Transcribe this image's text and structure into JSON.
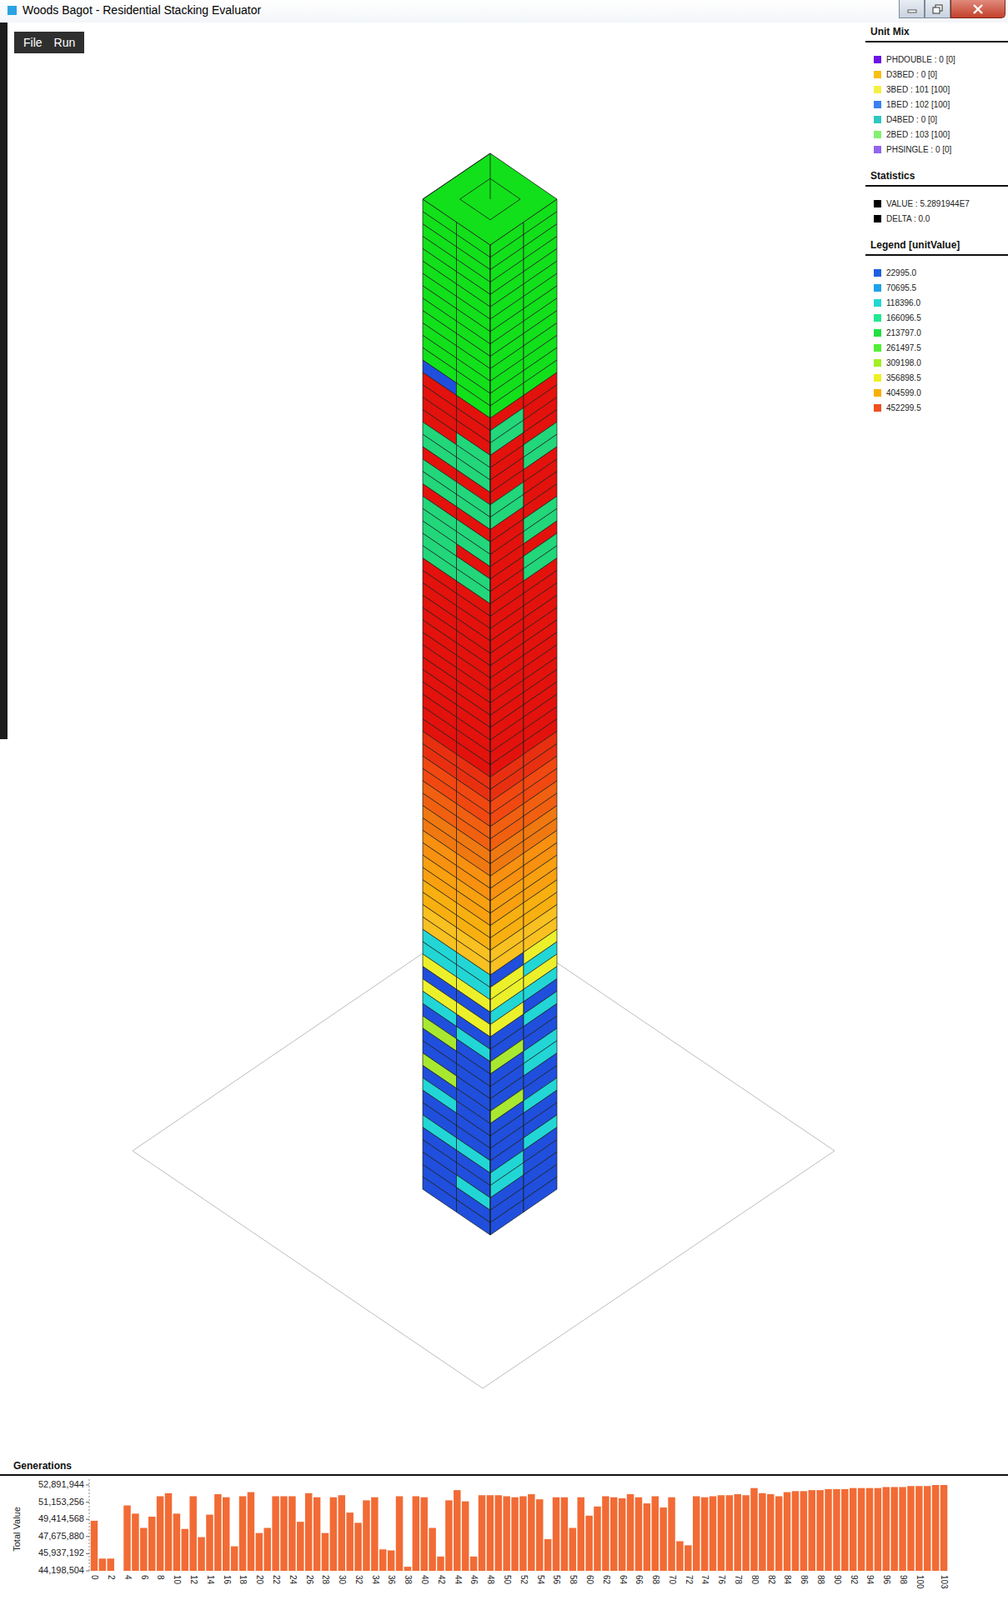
{
  "window": {
    "title": "Woods Bagot - Residential Stacking Evaluator"
  },
  "menu": [
    "File",
    "Run"
  ],
  "unit_mix": {
    "title": "Unit Mix",
    "items": [
      {
        "label": "PHDOUBLE : 0 [0]",
        "color": "#6b14e6"
      },
      {
        "label": "D3BED : 0 [0]",
        "color": "#f6c014"
      },
      {
        "label": "3BED : 101 [100]",
        "color": "#f4f046"
      },
      {
        "label": "1BED : 102 [100]",
        "color": "#3a82f0"
      },
      {
        "label": "D4BED : 0 [0]",
        "color": "#2ec8c0"
      },
      {
        "label": "2BED : 103 [100]",
        "color": "#84f070"
      },
      {
        "label": "PHSINGLE : 0 [0]",
        "color": "#9464f0"
      }
    ]
  },
  "statistics": {
    "title": "Statistics",
    "items": [
      {
        "label": "VALUE : 5.2891944E7",
        "color": "#000000"
      },
      {
        "label": "DELTA : 0.0",
        "color": "#000000"
      }
    ]
  },
  "legend": {
    "title": "Legend [unitValue]",
    "items": [
      {
        "label": "22995.0",
        "color": "#1f5fe0"
      },
      {
        "label": "70695.5",
        "color": "#1ea2ea"
      },
      {
        "label": "118396.0",
        "color": "#22d8d2"
      },
      {
        "label": "166096.5",
        "color": "#22e892"
      },
      {
        "label": "213797.0",
        "color": "#22e042"
      },
      {
        "label": "261497.5",
        "color": "#52f032"
      },
      {
        "label": "309198.0",
        "color": "#a2f022"
      },
      {
        "label": "356898.5",
        "color": "#f0f022"
      },
      {
        "label": "404599.0",
        "color": "#f8b000"
      },
      {
        "label": "452299.5",
        "color": "#f05020"
      }
    ]
  },
  "tower": {
    "roof_color": "#12e01a",
    "bands": [
      {
        "floors": 13,
        "units": [
          "#12e01a",
          "#12e01a",
          "#12e01a",
          "#12e01a"
        ]
      },
      {
        "floors": 1,
        "units": [
          "#1f4fdc",
          "#12e01a",
          "#12e01a",
          "#12e01a"
        ]
      },
      {
        "floors": 1,
        "units": [
          "#e3120c",
          "#e3120c",
          "#e3120c",
          "#e3120c"
        ]
      },
      {
        "floors": 2,
        "units": [
          "#e3120c",
          "#e3120c",
          "#22d67a",
          "#e3120c"
        ]
      },
      {
        "floors": 1,
        "units": [
          "#e3120c",
          "#22d67a",
          "#e3120c",
          "#e3120c"
        ]
      },
      {
        "floors": 2,
        "units": [
          "#22d67a",
          "#22d67a",
          "#e3120c",
          "#22d67a"
        ]
      },
      {
        "floors": 1,
        "units": [
          "#e3120c",
          "#e3120c",
          "#e3120c",
          "#e3120c"
        ]
      },
      {
        "floors": 2,
        "units": [
          "#22d67a",
          "#22d67a",
          "#22d67a",
          "#e3120c"
        ]
      },
      {
        "floors": 1,
        "units": [
          "#e3120c",
          "#e3120c",
          "#e3120c",
          "#e3120c"
        ]
      },
      {
        "floors": 2,
        "units": [
          "#22d67a",
          "#22d67a",
          "#e3120c",
          "#22d67a"
        ]
      },
      {
        "floors": 1,
        "units": [
          "#22d67a",
          "#e3120c",
          "#e3120c",
          "#e3120c"
        ]
      },
      {
        "floors": 2,
        "units": [
          "#22d67a",
          "#22d67a",
          "#e3120c",
          "#22d67a"
        ]
      },
      {
        "floors": 14,
        "units": [
          "#e3120c",
          "#e3120c",
          "#e3120c",
          "#e3120c"
        ]
      },
      {
        "floors": 2,
        "units": [
          "#e83010",
          "#e83010",
          "#e83010",
          "#e83010"
        ]
      },
      {
        "floors": 2,
        "units": [
          "#f04810",
          "#f04810",
          "#f04810",
          "#f04810"
        ]
      },
      {
        "floors": 2,
        "units": [
          "#f06010",
          "#f06010",
          "#f06010",
          "#f06010"
        ]
      },
      {
        "floors": 2,
        "units": [
          "#f07810",
          "#f07810",
          "#f07810",
          "#f07810"
        ]
      },
      {
        "floors": 2,
        "units": [
          "#f89010",
          "#f89010",
          "#f89010",
          "#f89010"
        ]
      },
      {
        "floors": 2,
        "units": [
          "#f8a010",
          "#f8a010",
          "#f8a010",
          "#f8a010"
        ]
      },
      {
        "floors": 2,
        "units": [
          "#f8b010",
          "#f8b010",
          "#f8b010",
          "#f8b010"
        ]
      },
      {
        "floors": 2,
        "units": [
          "#f8c020",
          "#f8c020",
          "#f8c020",
          "#f8c020"
        ]
      },
      {
        "floors": 1,
        "units": [
          "#22d6d6",
          "#22d6d6",
          "#1f4fdc",
          "#ecf02a"
        ]
      },
      {
        "floors": 1,
        "units": [
          "#22d6d6",
          "#22d6d6",
          "#ecf02a",
          "#22d6d6"
        ]
      },
      {
        "floors": 1,
        "units": [
          "#ecf02a",
          "#ecf02a",
          "#ecf02a",
          "#ecf02a"
        ]
      },
      {
        "floors": 1,
        "units": [
          "#1f4fdc",
          "#1f4fdc",
          "#22d6d6",
          "#22d6d6"
        ]
      },
      {
        "floors": 1,
        "units": [
          "#ecf02a",
          "#ecf02a",
          "#ecf02a",
          "#1f4fdc"
        ]
      },
      {
        "floors": 1,
        "units": [
          "#22d6d6",
          "#1f4fdc",
          "#1f4fdc",
          "#22d6d6"
        ]
      },
      {
        "floors": 1,
        "units": [
          "#1f4fdc",
          "#22d6d6",
          "#1f4fdc",
          "#1f4fdc"
        ]
      },
      {
        "floors": 1,
        "units": [
          "#a8e830",
          "#1f4fdc",
          "#a8e830",
          "#1f4fdc"
        ]
      },
      {
        "floors": 2,
        "units": [
          "#1f4fdc",
          "#1f4fdc",
          "#1f4fdc",
          "#22d6d6"
        ]
      },
      {
        "floors": 1,
        "units": [
          "#a8e830",
          "#1f4fdc",
          "#1f4fdc",
          "#1f4fdc"
        ]
      },
      {
        "floors": 1,
        "units": [
          "#1f4fdc",
          "#1f4fdc",
          "#a8e830",
          "#1f4fdc"
        ]
      },
      {
        "floors": 1,
        "units": [
          "#22d6d6",
          "#1f4fdc",
          "#1f4fdc",
          "#22d6d6"
        ]
      },
      {
        "floors": 2,
        "units": [
          "#1f4fdc",
          "#1f4fdc",
          "#1f4fdc",
          "#1f4fdc"
        ]
      },
      {
        "floors": 1,
        "units": [
          "#22d6d6",
          "#22d6d6",
          "#1f4fdc",
          "#22d6d6"
        ]
      },
      {
        "floors": 2,
        "units": [
          "#1f4fdc",
          "#1f4fdc",
          "#22d6d6",
          "#1f4fdc"
        ]
      },
      {
        "floors": 1,
        "units": [
          "#1f4fdc",
          "#22d6d6",
          "#1f4fdc",
          "#1f4fdc"
        ]
      },
      {
        "floors": 2,
        "units": [
          "#1f4fdc",
          "#1f4fdc",
          "#1f4fdc",
          "#1f4fdc"
        ]
      }
    ]
  },
  "generations": {
    "title": "Generations",
    "y_label": "Total Value",
    "y_ticks": [
      "52,891,944",
      "51,153,256",
      "49,414,568",
      "47,675,880",
      "45,937,192",
      "44,198,504"
    ],
    "x_ticks": [
      "0",
      "2",
      "4",
      "6",
      "8",
      "10",
      "12",
      "14",
      "16",
      "18",
      "20",
      "22",
      "24",
      "26",
      "28",
      "30",
      "32",
      "34",
      "36",
      "38",
      "40",
      "42",
      "44",
      "46",
      "48",
      "50",
      "52",
      "54",
      "56",
      "58",
      "60",
      "62",
      "64",
      "66",
      "68",
      "70",
      "72",
      "74",
      "76",
      "78",
      "80",
      "82",
      "84",
      "86",
      "88",
      "90",
      "92",
      "94",
      "96",
      "98",
      "100",
      "103"
    ],
    "values": [
      49269661,
      45440420,
      45440420,
      44198504,
      50822056,
      49994112,
      48545210,
      49683633,
      51753493,
      52063972,
      49994112,
      48441717,
      51753493,
      47613773,
      49890619,
      51960479,
      51650000,
      46682336,
      51753493,
      52167465,
      48027745,
      48545210,
      51753493,
      51753493,
      51753493,
      49166168,
      52063972,
      51650000,
      48027745,
      51650000,
      51856986,
      50097605,
      49062675,
      51339521,
      51650000,
      46371857,
      46268364,
      51753493,
      44612476,
      51753493,
      51650000,
      48545210,
      45647406,
      51339521,
      52374451,
      51236028,
      45647406,
      51856986,
      51856986,
      51856986,
      51753493,
      51650000,
      51753493,
      51960479,
      51443014,
      47406787,
      51650000,
      51650000,
      48545210,
      51650000,
      49787126,
      50718563,
      51753493,
      51650000,
      51546507,
      51960479,
      51650000,
      51029042,
      51753493,
      50615070,
      51650000,
      47199801,
      46785829,
      51753493,
      51650000,
      51753493,
      51856986,
      51856986,
      51960479,
      51856986,
      52581437,
      52063972,
      51960479,
      51753493,
      52167465,
      52270958,
      52270958,
      52374451,
      52374451,
      52477944,
      52477944,
      52477944,
      52581437,
      52581437,
      52581437,
      52581437,
      52684930,
      52684930,
      52684930,
      52788423,
      52788423,
      52788423,
      52891944,
      52891944
    ]
  }
}
